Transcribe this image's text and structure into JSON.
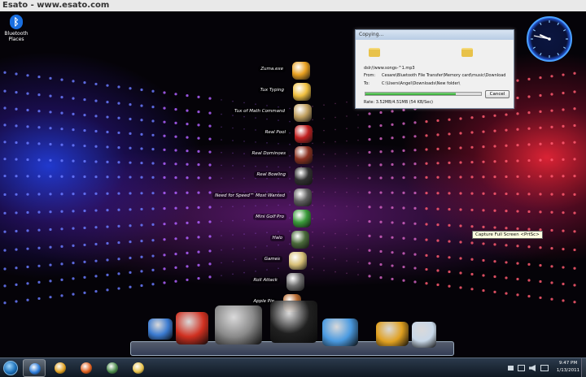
{
  "watermark": {
    "text": "Esato - www.esato.com"
  },
  "desktop_icons": [
    {
      "name": "bluetooth-places",
      "label": "Bluetooth Places",
      "icon": "bluetooth-icon",
      "color": "#1a6fe0"
    }
  ],
  "stack_menu": {
    "items": [
      {
        "label": "Zuma.exe",
        "icon": "zuma-icon",
        "color": "#e8a020"
      },
      {
        "label": "Tux Typing",
        "icon": "tux-icon",
        "color": "#f0c040"
      },
      {
        "label": "Tux of Math Command",
        "icon": "tux-math-icon",
        "color": "#c0a060"
      },
      {
        "label": "Real Pool",
        "icon": "pool-ball-icon",
        "color": "#c02020"
      },
      {
        "label": "Real Dominoes",
        "icon": "domino-icon",
        "color": "#8a3020"
      },
      {
        "label": "Real Bowling",
        "icon": "bowling-ball-icon",
        "color": "#303030"
      },
      {
        "label": "Need for Speed™ Most Wanted",
        "icon": "nfs-icon",
        "color": "#606060"
      },
      {
        "label": "Mini Golf Pro",
        "icon": "golf-ball-icon",
        "color": "#3a9a3a"
      },
      {
        "label": "Halo",
        "icon": "halo-icon",
        "color": "#4a6a3a"
      },
      {
        "label": "Games",
        "icon": "folder-icon",
        "color": "#d8c078"
      },
      {
        "label": "Roll Attack",
        "icon": "roll-attack-icon",
        "color": "#707070"
      },
      {
        "label": "Apple Pie",
        "icon": "apple-pie-icon",
        "color": "#b86a30"
      }
    ]
  },
  "copy_dialog": {
    "title": "Copying...",
    "filename": "dslr//www.songs-^1.mp3",
    "from_label": "From:",
    "from_path": "Cesare\\Bluetooth File Transfer\\Memory card\\music\\Download",
    "to_label": "To:",
    "to_path": "C:\\Users\\Angel\\Downloads\\New folder\\",
    "rate_text": "Rate: 3.52MB/4.51MB (54 KB/Sec)",
    "progress": 0.78,
    "cancel_label": "Cancel"
  },
  "clock_gadget": {
    "hour": 9,
    "minute": 47
  },
  "tooltip": {
    "text": "Capture Full Screen <PrtSc>"
  },
  "dock": {
    "items": [
      {
        "icon": "computer-icon",
        "color": "#3a7ad0"
      },
      {
        "icon": "ccleaner-icon",
        "color": "#d03020"
      },
      {
        "icon": "system-tools-icon",
        "color": "#8a8a8a"
      },
      {
        "icon": "gamepad-icon",
        "color": "#202020"
      },
      {
        "icon": "control-panel-icon",
        "color": "#4a9ae0"
      },
      {
        "icon": "maintenance-tools-icon",
        "color": "#e0a020"
      },
      {
        "icon": "recycle-bin-icon",
        "color": "#c8d8e8"
      }
    ]
  },
  "taskbar": {
    "buttons": [
      {
        "icon": "internet-explorer-icon",
        "color": "#2a7ad8",
        "active": true
      },
      {
        "icon": "chrome-icon",
        "color": "#e0a020",
        "active": false
      },
      {
        "icon": "media-player-icon",
        "color": "#e06020",
        "active": false
      },
      {
        "icon": "apps-icon",
        "color": "#4a8a4a",
        "active": false
      },
      {
        "icon": "explorer-folder-icon",
        "color": "#e8c24a",
        "active": false
      }
    ],
    "clock_time": "9:47 PM",
    "clock_date": "1/13/2011"
  }
}
